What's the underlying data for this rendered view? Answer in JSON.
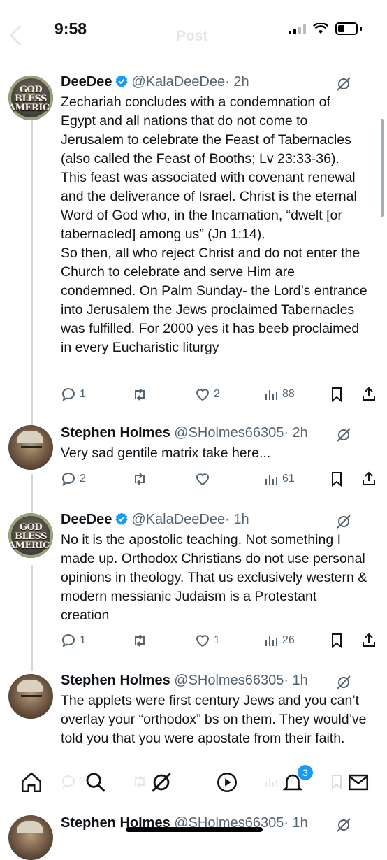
{
  "status": {
    "time": "9:58"
  },
  "header": {
    "title": "Post"
  },
  "tweets": [
    {
      "name": "DeeDee",
      "handle": "@KalaDeeDee",
      "time": "· 2h",
      "avatar_text": "GOD BLESS AMERICA",
      "body": "Zechariah concludes with a condemnation of Egypt and all nations that do not come to Jerusalem to celebrate the Feast of Tabernacles (also called the Feast of Booths; Lv 23:33-36). This feast was associated with covenant renewal and the deliverance of Israel. Christ is the eternal Word of God who, in the Incarnation, “dwelt [or tabernacled] among us” (Jn 1:14).\nSo then, all who reject Christ and do not enter the Church to celebrate and serve Him are condemned. On Palm Sunday- the Lord’s entrance into Jerusalem the Jews proclaimed Tabernacles was fulfilled. For 2000 yes it has beeb  proclaimed in every Eucharistic liturgy",
      "replies": "1",
      "retweets": "",
      "likes": "2",
      "views": "88"
    },
    {
      "name": "Stephen Holmes",
      "handle": "@SHolmes66305",
      "time": "· 2h",
      "body": "Very sad gentile matrix take here...",
      "replies": "2",
      "retweets": "",
      "likes": "",
      "views": "61"
    },
    {
      "name": "DeeDee",
      "handle": "@KalaDeeDee",
      "time": "· 1h",
      "avatar_text": "GOD BLESS AMERICA",
      "body": "No it is the apostolic teaching. Not something I made up. Orthodox Christians do not use personal opinions in theology. That us exclusively western & modern messianic Judaism is a Protestant creation",
      "replies": "1",
      "retweets": "",
      "likes": "1",
      "views": "26"
    },
    {
      "name": "Stephen Holmes",
      "handle": "@SHolmes66305",
      "time": "· 1h",
      "body": "The applets were first century Jews and you can’t overlay your “orthodox” bs on them. They would’ve told you that you were apostate from their faith.",
      "replies": "2",
      "retweets": "",
      "likes": "",
      "views": "27"
    },
    {
      "name": "Stephen Holmes",
      "handle": "@SHolmes66305",
      "time": "· 1h",
      "body": "",
      "replies": "",
      "retweets": "",
      "likes": "",
      "views": ""
    }
  ],
  "tabbar": {
    "notifications_badge": "3"
  },
  "colors": {
    "accent": "#1d9bf0",
    "muted": "#536471",
    "thread_line": "#cfd9de"
  }
}
